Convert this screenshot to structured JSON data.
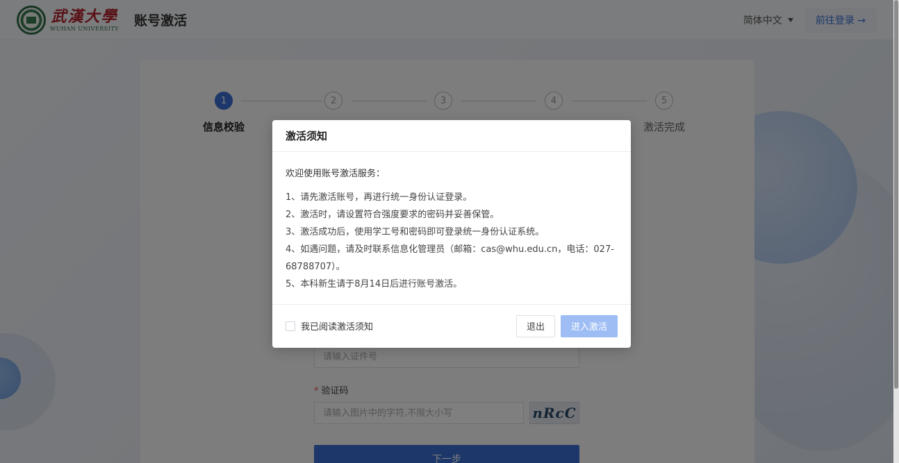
{
  "header": {
    "logo_cn": "武漢大學",
    "logo_en": "WUHAN UNIVERSITY",
    "title": "账号激活",
    "language": "简体中文",
    "login_link": "前往登录 →"
  },
  "steps": [
    {
      "num": "1",
      "label": "信息校验",
      "active": true
    },
    {
      "num": "2",
      "label": "",
      "active": false
    },
    {
      "num": "3",
      "label": "",
      "active": false
    },
    {
      "num": "4",
      "label": "",
      "active": false
    },
    {
      "num": "5",
      "label": "激活完成",
      "active": false
    }
  ],
  "form": {
    "id_placeholder": "请输入证件号",
    "captcha_label": "验证码",
    "captcha_placeholder": "请输入图片中的字符,不限大小写",
    "captcha_text": "nRcC",
    "next_label": "下一步"
  },
  "modal": {
    "title": "激活须知",
    "intro": "欢迎使用账号激活服务：",
    "lines": [
      "1、请先激活账号，再进行统一身份认证登录。",
      "2、激活时，请设置符合强度要求的密码并妥善保管。",
      "3、激活成功后，使用学工号和密码即可登录统一身份认证系统。",
      "4、如遇问题，请及时联系信息化管理员（邮箱：cas@whu.edu.cn，电话：027-",
      "68788707）。",
      "5、本科新生请于8月14日后进行账号激活。"
    ],
    "agree_label": "我已阅读激活须知",
    "quit_label": "退出",
    "enter_label": "进入激活"
  },
  "colors": {
    "accent": "#3b6fd4",
    "disabled_accent": "#9dbdf4",
    "brand_red": "#b3242e",
    "brand_green": "#2e6b46"
  }
}
